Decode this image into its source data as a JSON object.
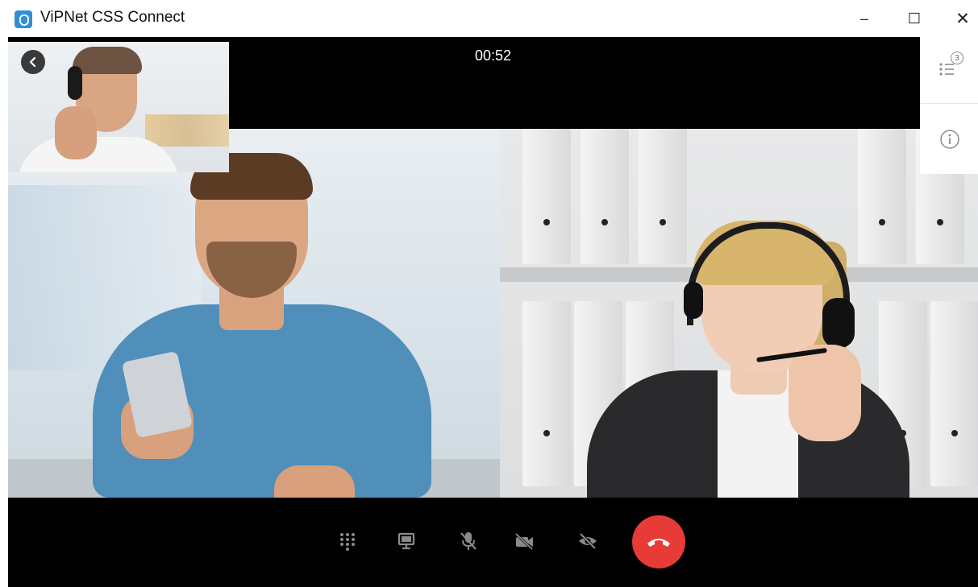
{
  "window": {
    "title": "ViPNet CSS Connect",
    "controls": {
      "minimize": "–",
      "maximize": "☐",
      "close": "✕"
    }
  },
  "call": {
    "timer": "00:52",
    "participants_count": "3"
  },
  "icons": {
    "app_logo": "vipnet-shield-icon",
    "back": "chevron-left-icon",
    "participants": "participants-list-icon",
    "info": "info-icon",
    "dialpad": "dialpad-icon",
    "screen_share": "screen-share-icon",
    "microphone": "microphone-muted-icon",
    "camera": "camera-off-icon",
    "visibility": "eye-off-icon",
    "hangup": "hang-up-icon"
  },
  "colors": {
    "hangup": "#e63b37",
    "app_logo": "#2f8fd8",
    "icon_gray": "#8a8a8a"
  }
}
